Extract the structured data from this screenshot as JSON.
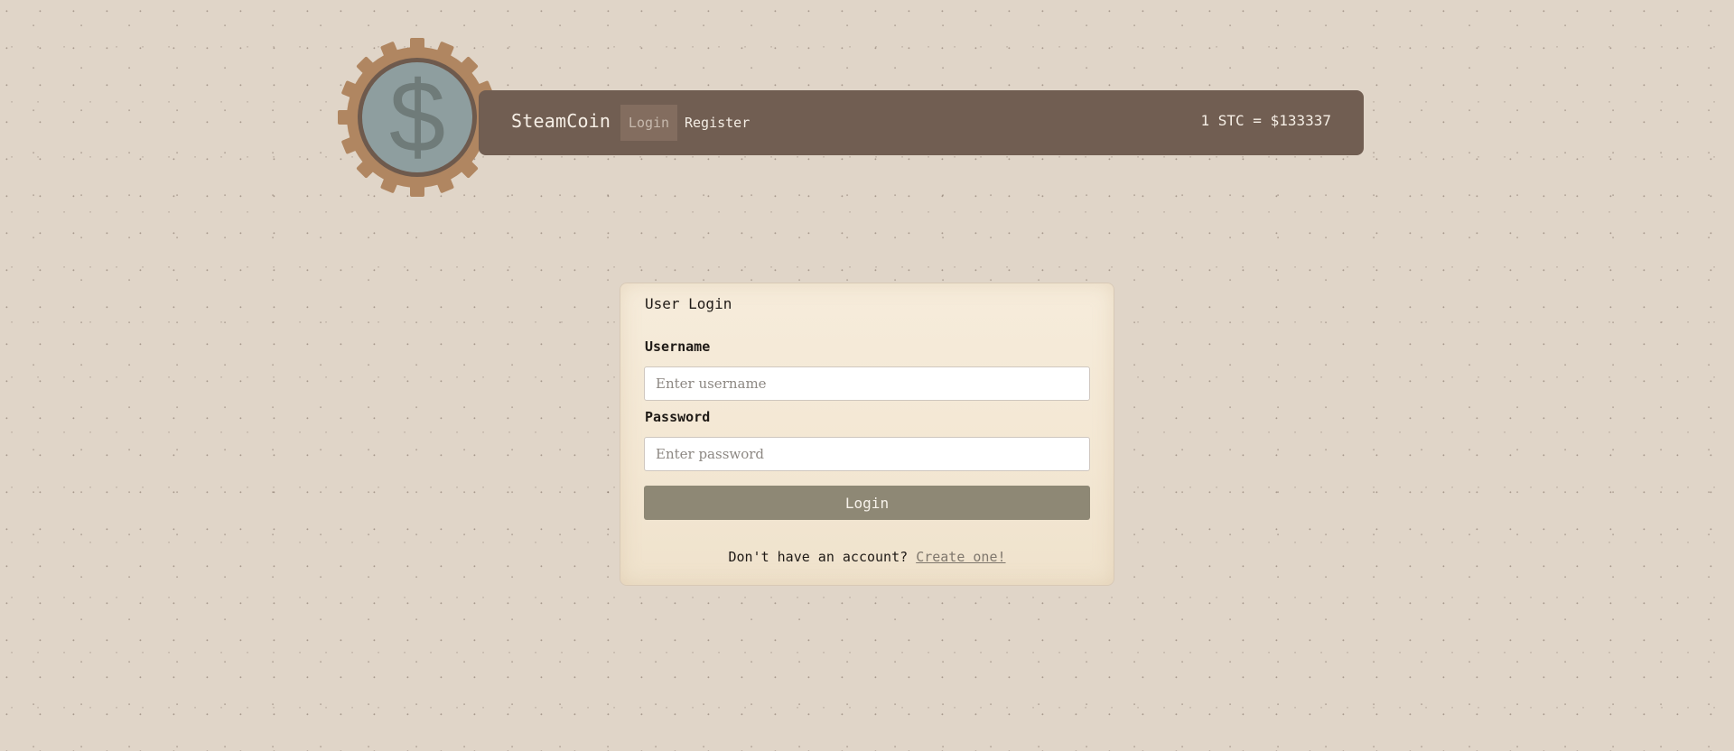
{
  "header": {
    "brand": "SteamCoin",
    "nav": {
      "login_label": "Login",
      "register_label": "Register"
    },
    "rate_text": "1 STC = $133337",
    "logo_icon": "gear-dollar-icon"
  },
  "login_card": {
    "title": "User Login",
    "username": {
      "label": "Username",
      "placeholder": "Enter username",
      "value": ""
    },
    "password": {
      "label": "Password",
      "placeholder": "Enter password",
      "value": ""
    },
    "submit_label": "Login",
    "signup_prompt": "Don't have an account?",
    "signup_link": "Create one!"
  },
  "colors": {
    "background": "#e0d5c8",
    "navbar": "#715e52",
    "nav_active": "#836d5f",
    "gear": "#b08661",
    "coin": "#8e9e9f",
    "button": "#8e8875",
    "card": "#f6ecdb"
  }
}
